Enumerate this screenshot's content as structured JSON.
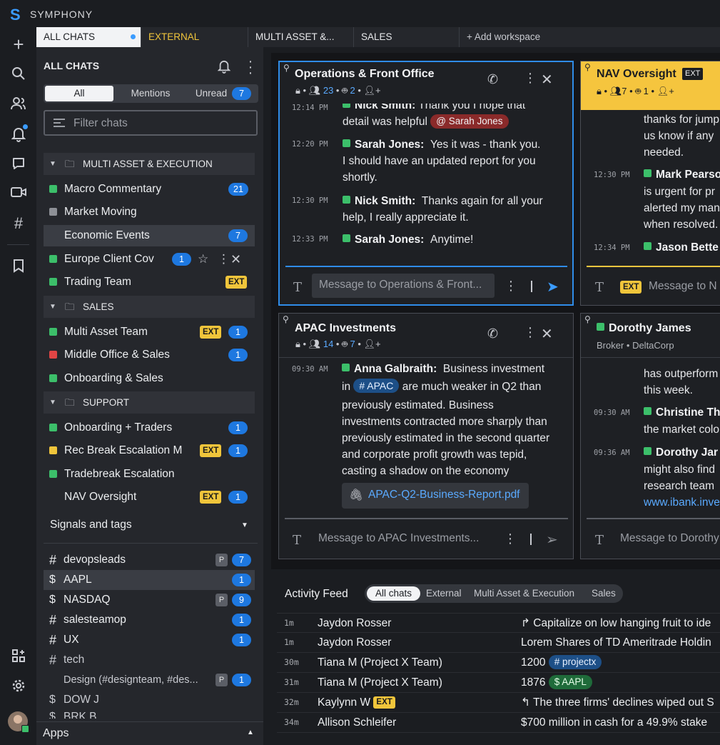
{
  "app": {
    "name": "SYMPHONY",
    "logo_letter": "S"
  },
  "rail": {
    "icons": [
      "plus-icon",
      "search-icon",
      "contacts-icon",
      "bell-icon",
      "chat-bubble-icon",
      "video-icon",
      "hashtag-icon",
      "bookmark-icon",
      "apps-grid-icon",
      "gear-icon"
    ]
  },
  "tabs": [
    {
      "label": "ALL CHATS"
    },
    {
      "label": "EXTERNAL"
    },
    {
      "label": "MULTI ASSET &..."
    },
    {
      "label": "SALES"
    },
    {
      "label": "+ Add workspace"
    }
  ],
  "sidebar": {
    "title": "ALL CHATS",
    "filter_tabs": {
      "all": "All",
      "mentions": "Mentions",
      "unread": "Unread",
      "unread_count": "7"
    },
    "filter_placeholder": "Filter chats",
    "sections": {
      "multi": "MULTI ASSET & EXECUTION",
      "sales": "SALES",
      "support": "SUPPORT"
    },
    "chats": {
      "macro": {
        "name": "Macro Commentary",
        "badge": "21"
      },
      "market": {
        "name": "Market Moving"
      },
      "econ": {
        "name": "Economic Events",
        "badge": "7"
      },
      "europe": {
        "name": "Europe Client Cov",
        "badge": "1"
      },
      "trading": {
        "name": "Trading Team",
        "ext": "EXT"
      },
      "multiteam": {
        "name": "Multi Asset Team",
        "ext": "EXT",
        "badge": "1"
      },
      "middle": {
        "name": "Middle Office & Sales",
        "badge": "1"
      },
      "onboardsales": {
        "name": "Onboarding & Sales"
      },
      "onboardtraders": {
        "name": "Onboarding + Traders",
        "badge": "1"
      },
      "recbreak": {
        "name": "Rec Break Escalation M",
        "ext": "EXT",
        "badge": "1"
      },
      "tradebreak": {
        "name": "Tradebreak Escalation"
      },
      "nav": {
        "name": "NAV Oversight",
        "ext": "EXT",
        "badge": "1"
      }
    },
    "signals_title": "Signals and tags",
    "signals": {
      "devops": {
        "sym": "#",
        "name": "devopsleads",
        "p": "P",
        "badge": "7"
      },
      "aapl": {
        "sym": "$",
        "name": "AAPL",
        "badge": "1"
      },
      "nasdaq": {
        "sym": "$",
        "name": "NASDAQ",
        "p": "P",
        "badge": "9"
      },
      "salesteam": {
        "sym": "#",
        "name": "salesteamop",
        "badge": "1"
      },
      "ux": {
        "sym": "#",
        "name": "UX",
        "badge": "1"
      },
      "tech": {
        "sym": "#",
        "name": "tech"
      },
      "design": {
        "name": "Design (#designteam, #des...",
        "p": "P",
        "badge": "1"
      },
      "dow": {
        "sym": "$",
        "name": "DOW J"
      },
      "brk": {
        "sym": "$",
        "name": "BRK.B"
      }
    },
    "apps_label": "Apps"
  },
  "cards": {
    "ops": {
      "title": "Operations & Front Office",
      "members": "23",
      "bots": "2",
      "messages": [
        {
          "time": "12:14 PM",
          "author": "Nick Smith:",
          "text1": "Thank you I hope that",
          "text2": "detail was helpful",
          "mention": "Sarah Jones"
        },
        {
          "time": "12:20 PM",
          "author": "Sarah Jones:",
          "text1": "Yes it was - thank you.",
          "text2": "I should have an updated report for you",
          "text3": "shortly."
        },
        {
          "time": "12:30 PM",
          "author": "Nick Smith:",
          "text1": "Thanks again for all your",
          "text2": "help, I really appreciate it."
        },
        {
          "time": "12:33 PM",
          "author": "Sarah Jones:",
          "text1": "Anytime!"
        }
      ],
      "composer": "Message to Operations & Front..."
    },
    "nav": {
      "title": "NAV Oversight",
      "ext": "EXT",
      "members": "7",
      "bots": "1",
      "lines": [
        "thanks for jump",
        "us know if any",
        "needed."
      ],
      "m2": {
        "time": "12:30 PM",
        "author": "Mark Pearso",
        "lines": [
          "is urgent for pr",
          "alerted my man",
          "when resolved."
        ]
      },
      "m3": {
        "time": "12:34 PM",
        "author": "Jason Bette"
      },
      "composer": "Message to N"
    },
    "apac": {
      "title": "APAC Investments",
      "members": "14",
      "bots": "7",
      "time": "09:30 AM",
      "author": "Anna Galbraith:",
      "l1": "Business investment",
      "l2a": "in",
      "tag": "APAC",
      "l2b": "are much weaker in Q2 than",
      "l3": "previously estimated. Business",
      "l4": "investments contracted more sharply than",
      "l5": "previously estimated in the second quarter",
      "l6": "and corporate profit growth was tepid,",
      "l7": "casting a shadow on the economy",
      "file": "APAC-Q2-Business-Report.pdf",
      "composer": "Message to APAC Investments..."
    },
    "dorothy": {
      "title": "Dorothy James",
      "subtitle": "Broker • DeltaCorp",
      "lines": [
        "has outperform",
        "this week."
      ],
      "m2": {
        "time": "09:30 AM",
        "author": "Christine Th",
        "line": "the market colo"
      },
      "m3": {
        "time": "09:36 AM",
        "author": "Dorothy Jar",
        "lines": [
          "might also find",
          "research team"
        ],
        "link": "www.ibank.inve"
      },
      "composer": "Message to Dorothy"
    }
  },
  "feed": {
    "title": "Activity Feed",
    "filters": [
      "All chats",
      "External",
      "Multi Asset & Execution",
      "Sales"
    ],
    "rows": [
      {
        "t": "1m",
        "name": "Jaydon Rosser",
        "msg": "↱ Capitalize on low hanging fruit to ide"
      },
      {
        "t": "1m",
        "name": "Jaydon Rosser",
        "msg": "Lorem Shares of TD Ameritrade Holdin"
      },
      {
        "t": "30m",
        "name": "Tiana M (Project X Team)",
        "msg": "1200",
        "chip": "# projectx"
      },
      {
        "t": "31m",
        "name": "Tiana M (Project X Team)",
        "msg": "1876",
        "chip": "$ AAPL"
      },
      {
        "t": "32m",
        "name": "Kaylynn W",
        "ext": "EXT",
        "msg": "↰ The three firms' declines wiped out S"
      },
      {
        "t": "34m",
        "name": "Allison Schleifer",
        "msg": "$700 million in cash for a 49.9% stake"
      }
    ]
  },
  "colors": {
    "accent": "#1e78e0",
    "ext": "#f0c53b",
    "green": "#3cbf6a"
  }
}
